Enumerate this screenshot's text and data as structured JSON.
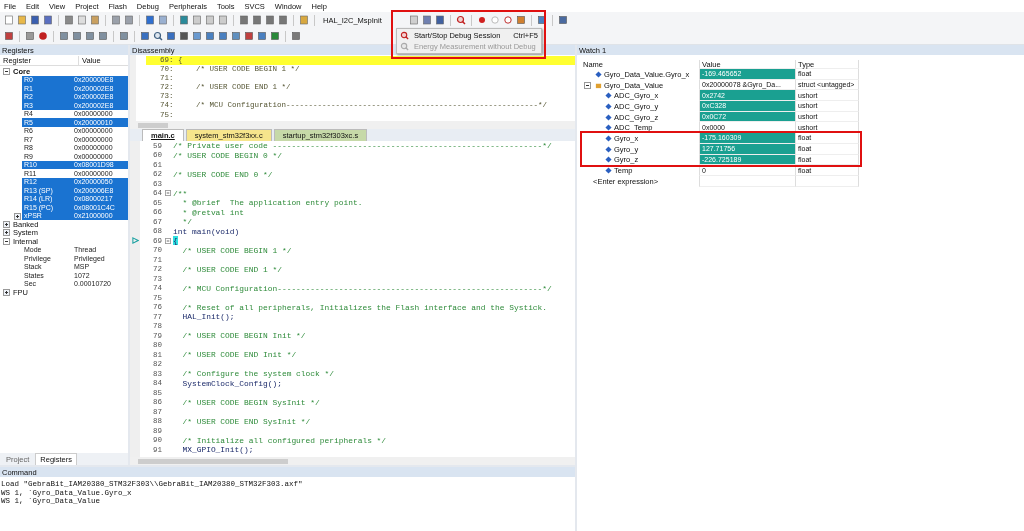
{
  "menu": [
    "File",
    "Edit",
    "View",
    "Project",
    "Flash",
    "Debug",
    "Peripherals",
    "Tools",
    "SVCS",
    "Window",
    "Help"
  ],
  "toolbar": {
    "function_combo": "HAL_I2C_MspInit"
  },
  "debug_menu": {
    "items": [
      {
        "label": "Start/Stop Debug Session",
        "shortcut": "Ctrl+F5",
        "disabled": false
      },
      {
        "label": "Energy Measurement without Debug",
        "disabled": true
      }
    ]
  },
  "registers": {
    "title": "Registers",
    "columns": [
      "Register",
      "Value"
    ],
    "tree": [
      {
        "name": "Core",
        "expanded": true,
        "children": [
          {
            "name": "R0",
            "value": "0x200000E8",
            "selected": true
          },
          {
            "name": "R1",
            "value": "0x200002E8",
            "selected": true
          },
          {
            "name": "R2",
            "value": "0x200002E8",
            "selected": true
          },
          {
            "name": "R3",
            "value": "0x200002E8",
            "selected": true
          },
          {
            "name": "R4",
            "value": "0x00000000",
            "selected": false
          },
          {
            "name": "R5",
            "value": "0x20000010",
            "selected": true
          },
          {
            "name": "R6",
            "value": "0x00000000",
            "selected": false
          },
          {
            "name": "R7",
            "value": "0x00000000",
            "selected": false
          },
          {
            "name": "R8",
            "value": "0x00000000",
            "selected": false
          },
          {
            "name": "R9",
            "value": "0x00000000",
            "selected": false
          },
          {
            "name": "R10",
            "value": "0x08001D98",
            "selected": true
          },
          {
            "name": "R11",
            "value": "0x00000000",
            "selected": false
          },
          {
            "name": "R12",
            "value": "0x20000050",
            "selected": true
          },
          {
            "name": "R13 (SP)",
            "value": "0x200006E8",
            "selected": true
          },
          {
            "name": "R14 (LR)",
            "value": "0x08000217",
            "selected": true
          },
          {
            "name": "R15 (PC)",
            "value": "0x08001C4C",
            "selected": true
          },
          {
            "name": "xPSR",
            "value": "0x21000000",
            "selected": true,
            "expanded": false
          }
        ]
      },
      {
        "name": "Banked",
        "expanded": false
      },
      {
        "name": "System",
        "expanded": false
      },
      {
        "name": "Internal",
        "expanded": true,
        "children": [
          {
            "name": "Mode",
            "value": "Thread",
            "selected": false
          },
          {
            "name": "Privilege",
            "value": "Privileged",
            "selected": false
          },
          {
            "name": "Stack",
            "value": "MSP",
            "selected": false
          },
          {
            "name": "States",
            "value": "1072",
            "selected": false
          },
          {
            "name": "Sec",
            "value": "0.00010720",
            "selected": false
          }
        ]
      },
      {
        "name": "FPU",
        "expanded": false
      }
    ],
    "bottom_tabs": [
      {
        "label": "Project",
        "selected": false
      },
      {
        "label": "Registers",
        "selected": true
      }
    ]
  },
  "disassembly": {
    "title": "Disassembly",
    "lines": [
      {
        "text": "69: {",
        "current": true
      },
      {
        "text": "70:     /* USER CODE BEGIN 1 */",
        "current": false
      },
      {
        "text": "71:",
        "current": false
      },
      {
        "text": "72:     /* USER CODE END 1 */",
        "current": false
      },
      {
        "text": "73:",
        "current": false
      },
      {
        "text": "74:     /* MCU Configuration--------------------------------------------------------*/",
        "current": false
      },
      {
        "text": "75:",
        "current": false
      }
    ]
  },
  "editor": {
    "tabs": [
      {
        "label": "main.c",
        "selected": true,
        "color": "#ffffff"
      },
      {
        "label": "system_stm32f3xx.c",
        "selected": false,
        "color": "#f6e58c"
      },
      {
        "label": "startup_stm32f303xc.s",
        "selected": false,
        "color": "#c6d9a8"
      }
    ],
    "lines": [
      {
        "number": "59",
        "text": "/* Private user code ---------------------------------------------------------*/",
        "kind": "comment",
        "fold": false,
        "current": false
      },
      {
        "number": "60",
        "text": "/* USER CODE BEGIN 0 */",
        "kind": "comment",
        "fold": false,
        "current": false
      },
      {
        "number": "61",
        "fold": false,
        "current": false
      },
      {
        "number": "62",
        "text": "/* USER CODE END 0 */",
        "kind": "comment",
        "fold": false,
        "current": false
      },
      {
        "number": "63",
        "fold": false,
        "current": false
      },
      {
        "number": "64",
        "text": "/**",
        "kind": "comment",
        "fold": true,
        "current": false
      },
      {
        "number": "65",
        "text": "  * @brief  The application entry point.",
        "kind": "comment",
        "fold": false,
        "current": false
      },
      {
        "number": "66",
        "text": "  * @retval int",
        "kind": "comment",
        "fold": false,
        "current": false
      },
      {
        "number": "67",
        "text": "  */",
        "kind": "comment",
        "fold": false,
        "current": false
      },
      {
        "number": "68",
        "text": "int main(void)",
        "kind": "code",
        "fold": false,
        "current": false
      },
      {
        "number": "69",
        "text": "{",
        "kind": "code",
        "fold": true,
        "current": true
      },
      {
        "number": "70",
        "text": "  /* USER CODE BEGIN 1 */",
        "kind": "comment",
        "fold": false,
        "current": false
      },
      {
        "number": "71",
        "fold": false,
        "current": false
      },
      {
        "number": "72",
        "text": "  /* USER CODE END 1 */",
        "kind": "comment",
        "fold": false,
        "current": false
      },
      {
        "number": "73",
        "fold": false,
        "current": false
      },
      {
        "number": "74",
        "text": "  /* MCU Configuration--------------------------------------------------------*/",
        "kind": "comment",
        "fold": false,
        "current": false
      },
      {
        "number": "75",
        "fold": false,
        "current": false
      },
      {
        "number": "76",
        "text": "  /* Reset of all peripherals, Initializes the Flash interface and the Systick.",
        "kind": "comment",
        "fold": false,
        "current": false
      },
      {
        "number": "77",
        "text": "  HAL_Init();",
        "kind": "code",
        "fold": false,
        "current": false
      },
      {
        "number": "78",
        "fold": false,
        "current": false
      },
      {
        "number": "79",
        "text": "  /* USER CODE BEGIN Init */",
        "kind": "comment",
        "fold": false,
        "current": false
      },
      {
        "number": "80",
        "fold": false,
        "current": false
      },
      {
        "number": "81",
        "text": "  /* USER CODE END Init */",
        "kind": "comment",
        "fold": false,
        "current": false
      },
      {
        "number": "82",
        "fold": false,
        "current": false
      },
      {
        "number": "83",
        "text": "  /* Configure the system clock */",
        "kind": "comment",
        "fold": false,
        "current": false
      },
      {
        "number": "84",
        "text": "  SystemClock_Config();",
        "kind": "code",
        "fold": false,
        "current": false
      },
      {
        "number": "85",
        "fold": false,
        "current": false
      },
      {
        "number": "86",
        "text": "  /* USER CODE BEGIN SysInit */",
        "kind": "comment",
        "fold": false,
        "current": false
      },
      {
        "number": "87",
        "fold": false,
        "current": false
      },
      {
        "number": "88",
        "text": "  /* USER CODE END SysInit */",
        "kind": "comment",
        "fold": false,
        "current": false
      },
      {
        "number": "89",
        "fold": false,
        "current": false
      },
      {
        "number": "90",
        "text": "  /* Initialize all configured peripherals */",
        "kind": "comment",
        "fold": false,
        "current": false
      },
      {
        "number": "91",
        "text": "  MX_GPIO_Init();",
        "kind": "code",
        "fold": false,
        "current": false
      }
    ]
  },
  "command": {
    "title": "Command",
    "lines": [
      "Load \"GebraBit_IAM20380_STM32F303\\\\GebraBit_IAM20380_STM32F303.axf\"",
      "WS 1, `Gyro_Data_Value.Gyro_x",
      "WS 1, `Gyro_Data_Value"
    ]
  },
  "watch": {
    "title": "Watch 1",
    "columns": [
      "Name",
      "Value",
      "Type"
    ],
    "rows": [
      {
        "name": "Gyro_Data_Value.Gyro_x",
        "value": "-169.465652",
        "type": "float",
        "changed": true
      },
      {
        "name": "Gyro_Data_Value",
        "value": "0x20000078 &Gyro_Da...",
        "type": "struct <untagged>",
        "changed": false,
        "expanded": true,
        "children": [
          {
            "name": "ADC_Gyro_x",
            "value": "0x2742",
            "type": "ushort",
            "changed": true
          },
          {
            "name": "ADC_Gyro_y",
            "value": "0xC328",
            "type": "ushort",
            "changed": true
          },
          {
            "name": "ADC_Gyro_z",
            "value": "0x0C72",
            "type": "ushort",
            "changed": true
          },
          {
            "name": "ADC_Temp",
            "value": "0x0000",
            "type": "ushort",
            "changed": false
          },
          {
            "name": "Gyro_x",
            "value": "-175.160309",
            "type": "float",
            "changed": true
          },
          {
            "name": "Gyro_y",
            "value": "127.71756",
            "type": "float",
            "changed": true
          },
          {
            "name": "Gyro_z",
            "value": "-226.725189",
            "type": "float",
            "changed": true
          },
          {
            "name": "Temp",
            "value": "0",
            "type": "float",
            "changed": false
          }
        ]
      }
    ],
    "enter_expression": "<Enter expression>"
  }
}
